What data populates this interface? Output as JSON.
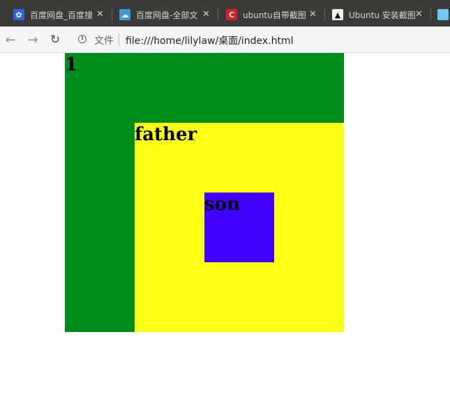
{
  "tabs": [
    {
      "title": "百度网盘_百度搜",
      "favicon": "baidu-paw-icon"
    },
    {
      "title": "百度网盘-全部文",
      "favicon": "baidu-netdisk-icon"
    },
    {
      "title": "ubuntu自带截图",
      "favicon": "csdn-icon"
    },
    {
      "title": "Ubuntu 安装截图",
      "favicon": "linux-tux-icon"
    }
  ],
  "toolbar": {
    "scheme_label": "文件",
    "url": "file:///home/lilylaw/桌面/index.html",
    "back_icon": "←",
    "forward_icon": "→",
    "reload_icon": "↻",
    "info_icon": "i"
  },
  "page": {
    "box1_text": "1",
    "father_text": "father",
    "son_text": "son"
  },
  "colors": {
    "box1": "#008c1a",
    "father": "#faff13",
    "son": "#4100ff",
    "tab_strip": "#3b3a37"
  }
}
